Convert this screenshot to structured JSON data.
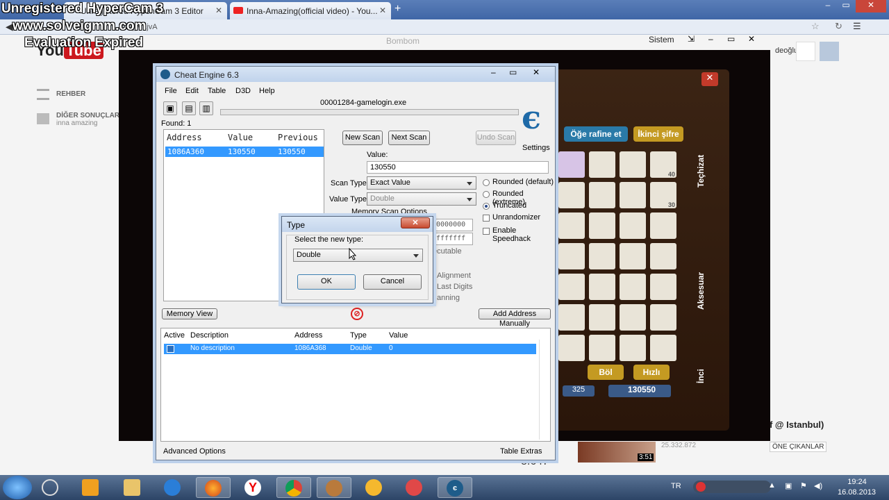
{
  "browser": {
    "tabs": [
      {
        "label": "Unregistered HypenCam 3 Editor"
      },
      {
        "label": "Inna-Amazing(official video) - You..."
      }
    ],
    "url": "www.solveigmm.com Vce_M1jvA",
    "window_controls": [
      "–",
      "▭",
      "✕"
    ]
  },
  "watermark": {
    "line1": "Unregistered HyperCam 3",
    "line2": "www.solveigmm.com",
    "line3": "Evaluation Expired"
  },
  "youtube": {
    "logo_text": "You",
    "logo_tube": "Tube",
    "nav": [
      {
        "label": "REHBER"
      },
      {
        "label": "DİĞER SONUÇLAR",
        "sub": "inna amazing"
      }
    ],
    "user_suffix": "deoğlu",
    "side_title": "of @ Istanbul)",
    "side_views": "25.332.872",
    "side_badge": "ÖNE ÇIKANLAR",
    "side_duration": "3:51",
    "views_partial": "8.647"
  },
  "player": {
    "title": "Bombom",
    "sistem_label": "Sistem",
    "controls": [
      "⇲",
      "–",
      "▭",
      "✕"
    ],
    "game": {
      "tabs": [
        "Öğe rafine et",
        "İkinci şifre"
      ],
      "side_labels": [
        "Teçhizat",
        "Aksesuar",
        "İnci"
      ],
      "buttons": [
        "Böl",
        "Hızlı"
      ],
      "money": "130550",
      "money_small": "325",
      "stack_counts": [
        "40",
        "30"
      ]
    }
  },
  "cheat_engine": {
    "title": "Cheat Engine 6.3",
    "menu": [
      "File",
      "Edit",
      "Table",
      "D3D",
      "Help"
    ],
    "process": "00001284-gamelogin.exe",
    "found": "Found: 1",
    "results_headers": [
      "Address",
      "Value",
      "Previous"
    ],
    "result_row": {
      "address": "1086A360",
      "value": "130550",
      "previous": "130550"
    },
    "new_scan": "New Scan",
    "next_scan": "Next Scan",
    "undo_scan": "Undo Scan",
    "settings": "Settings",
    "value_label": "Value:",
    "value": "130550",
    "scan_type_label": "Scan Type",
    "scan_type": "Exact Value",
    "value_type_label": "Value Type",
    "value_type": "Double",
    "memory_scan_options": "Memory Scan Options",
    "start_partial": "0000000",
    "stop_partial": "fffffff",
    "executable_partial": "ecutable",
    "alignment_partial": "Alignment",
    "last_digits_partial": "Last Digits",
    "scanning_partial": "anning",
    "radios": [
      {
        "label": "Rounded (default)",
        "checked": false
      },
      {
        "label": "Rounded (extreme)",
        "checked": false
      },
      {
        "label": "Truncated",
        "checked": true
      }
    ],
    "checks": [
      {
        "label": "Unrandomizer",
        "checked": false
      },
      {
        "label": "Enable Speedhack",
        "checked": false
      }
    ],
    "memory_view": "Memory View",
    "add_address": "Add Address Manually",
    "table_headers": [
      "Active",
      "Description",
      "Address",
      "Type",
      "Value"
    ],
    "table_row": {
      "description": "No description",
      "address": "1086A368",
      "type": "Double",
      "value": "0"
    },
    "advanced_options": "Advanced Options",
    "table_extras": "Table Extras"
  },
  "type_dialog": {
    "title": "Type",
    "close": "✕",
    "prompt": "Select the new type:",
    "selected": "Double",
    "ok": "OK",
    "cancel": "Cancel"
  },
  "taskbar": {
    "lang": "TR",
    "time": "19:24",
    "date": "16.08.2013"
  }
}
